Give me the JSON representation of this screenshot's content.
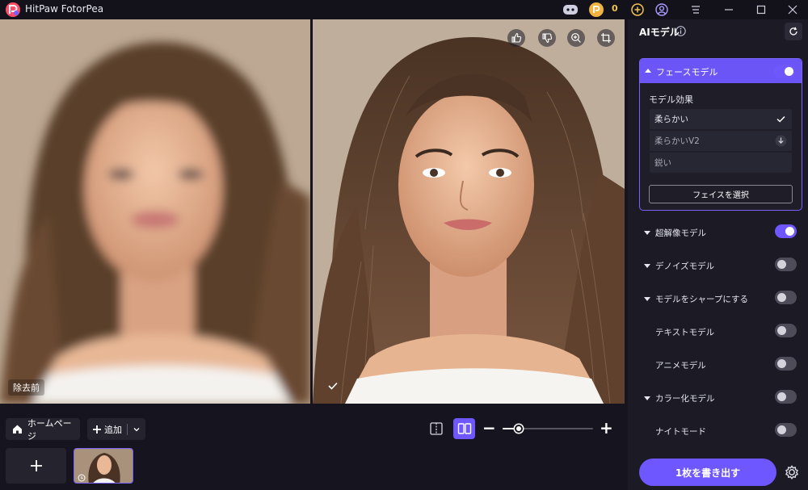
{
  "app": {
    "title": "HitPaw FotorPea",
    "coin_count": "0"
  },
  "preview": {
    "before_label": "除去前"
  },
  "bottom_bar": {
    "home_label": "ホームページ",
    "add_label": "追加",
    "zoom_level": 0.18
  },
  "panel": {
    "title": "AIモデル",
    "face_model": {
      "label": "フェースモデル",
      "enabled": true,
      "effect_label": "モデル効果",
      "options": [
        {
          "label": "柔らかい",
          "selected": true,
          "icon": "check-icon"
        },
        {
          "label": "柔らかいV2",
          "selected": false,
          "icon": "download-icon"
        },
        {
          "label": "鋭い",
          "selected": false,
          "icon": ""
        }
      ],
      "select_face_label": "フェイスを選択"
    },
    "models": [
      {
        "label": "超解像モデル",
        "enabled": true,
        "expandable": true
      },
      {
        "label": "デノイズモデル",
        "enabled": false,
        "expandable": true
      },
      {
        "label": "モデルをシャープにする",
        "enabled": false,
        "expandable": true
      },
      {
        "label": "テキストモデル",
        "enabled": false,
        "expandable": false
      },
      {
        "label": "アニメモデル",
        "enabled": false,
        "expandable": false
      },
      {
        "label": "カラー化モデル",
        "enabled": false,
        "expandable": true
      },
      {
        "label": "ナイトモード",
        "enabled": false,
        "expandable": false
      }
    ],
    "export_label": "1枚を書き出す"
  },
  "colors": {
    "accent": "#6e57ff",
    "background": "#16151f",
    "panel": "#1b1a25"
  }
}
